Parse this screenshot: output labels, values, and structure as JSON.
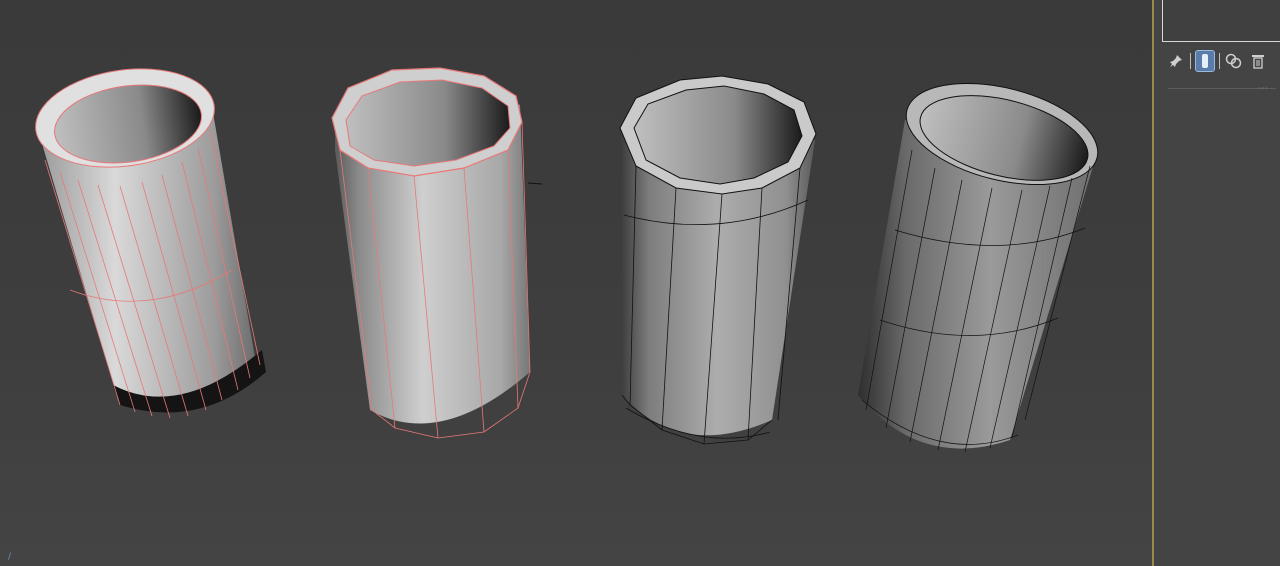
{
  "viewport": {
    "objects": [
      {
        "name": "cylinder-selected-smooth",
        "selected": true
      },
      {
        "name": "cylinder-selected-faceted",
        "selected": true
      },
      {
        "name": "cylinder-faceted-wire",
        "selected": false
      },
      {
        "name": "cylinder-smooth-wire",
        "selected": false
      }
    ],
    "colors": {
      "selection_edge": "#e87878",
      "wire_edge": "#111111",
      "background": "#3c3c3c"
    }
  },
  "panel": {
    "toolbar": [
      {
        "icon": "pin-icon",
        "active": false
      },
      {
        "icon": "show-end-result-icon",
        "active": true
      },
      {
        "icon": "make-unique-icon",
        "active": false
      },
      {
        "icon": "trash-icon",
        "active": false
      }
    ]
  }
}
